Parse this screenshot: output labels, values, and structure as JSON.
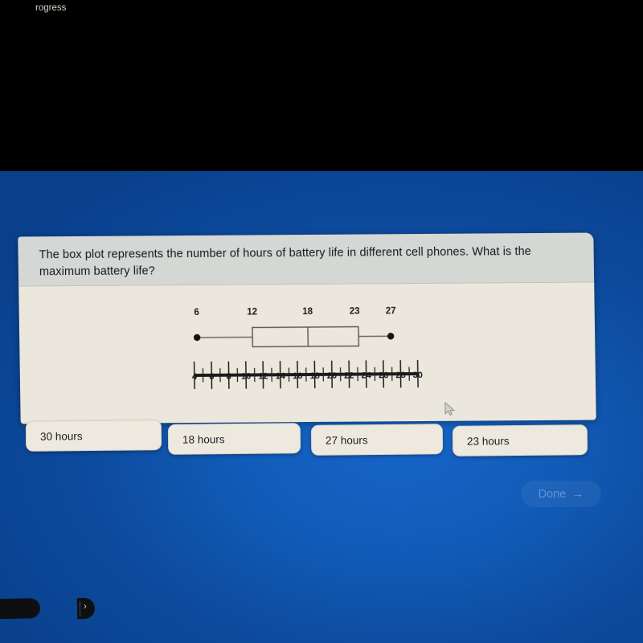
{
  "top_bar": {
    "color": "#000000"
  },
  "background": {
    "color": "#0d4b9e"
  },
  "worksheet": {
    "question": "The box plot represents the number of hours of battery life in different cell phones. What is the maximum battery life?",
    "header_color": "#d5d7d4",
    "paper_color": "#ece7dc"
  },
  "chart_data": {
    "type": "boxplot",
    "title": "",
    "xlabel": "",
    "ylabel": "",
    "xlim": [
      4,
      30
    ],
    "grid": false,
    "legend": "none",
    "axis_major_step": 2,
    "axis_minor_step": 1,
    "tick_labels": [
      "4",
      "6",
      "8",
      "10",
      "12",
      "14",
      "16",
      "18",
      "20",
      "22",
      "24",
      "26",
      "28",
      "30"
    ],
    "tick_values": [
      4,
      6,
      8,
      10,
      12,
      14,
      16,
      18,
      20,
      22,
      24,
      26,
      28,
      30
    ],
    "series": [
      {
        "name": "Battery life (hours)",
        "min": 6,
        "q1": 12,
        "median": 18,
        "q3": 23,
        "max": 27,
        "whisker_end_style": "dot"
      }
    ],
    "data_labels": [
      "6",
      "12",
      "18",
      "23",
      "27"
    ],
    "data_label_values": [
      6,
      12,
      18,
      23,
      27
    ]
  },
  "answers": {
    "options": [
      {
        "label": "30 hours",
        "value": 30
      },
      {
        "label": "18 hours",
        "value": 18
      },
      {
        "label": "27 hours",
        "value": 27
      },
      {
        "label": "23 hours",
        "value": 23
      }
    ]
  },
  "footer": {
    "done_label": "Done",
    "done_arrow": "→",
    "progress_label": "rogress",
    "progress_chevron": "›"
  }
}
